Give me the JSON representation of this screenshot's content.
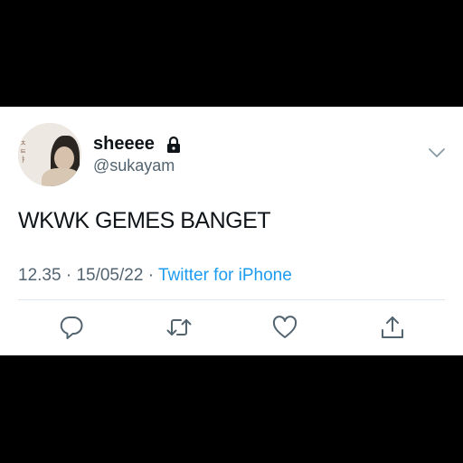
{
  "tweet": {
    "display_name": "sheeee",
    "handle": "@sukayam",
    "text": "WKWK GEMES BANGET",
    "time": "12.35",
    "date": "15/05/22",
    "separator": "·",
    "source": "Twitter for iPhone",
    "protected_icon": "lock-icon"
  },
  "actions": [
    {
      "name": "reply",
      "icon": "reply-icon"
    },
    {
      "name": "retweet",
      "icon": "retweet-icon"
    },
    {
      "name": "like",
      "icon": "heart-icon"
    },
    {
      "name": "share",
      "icon": "share-icon"
    }
  ],
  "colors": {
    "text": "#0f1419",
    "secondary": "#536471",
    "link": "#1d9bf0",
    "background": "#ffffff",
    "letterbox": "#000000"
  }
}
